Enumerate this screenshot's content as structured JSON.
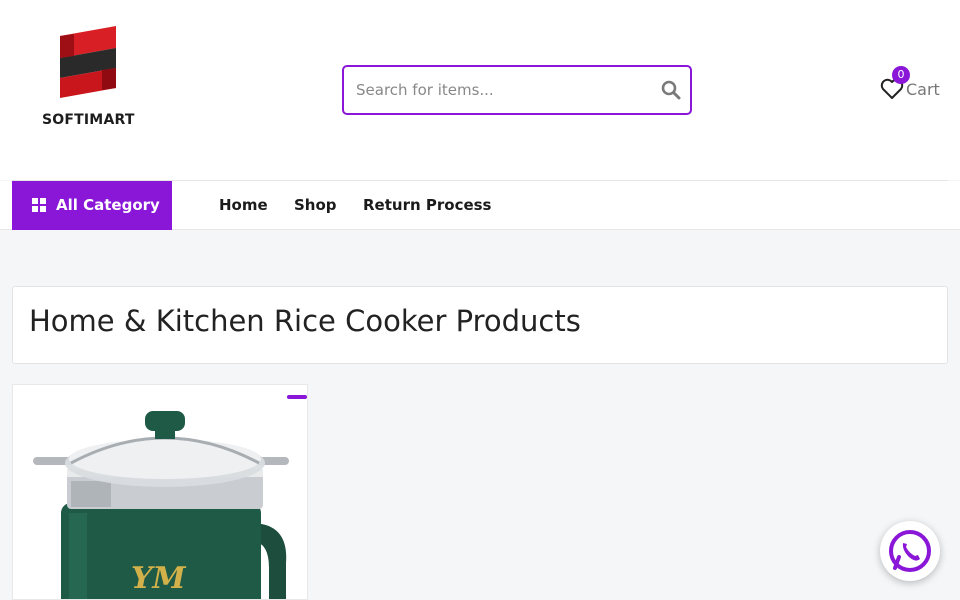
{
  "brand": {
    "name": "SOFTIMART"
  },
  "search": {
    "placeholder": "Search for items..."
  },
  "cart": {
    "count": "0",
    "label": "Cart"
  },
  "nav": {
    "all_category": "All Category",
    "links": [
      "Home",
      "Shop",
      "Return Process"
    ]
  },
  "page": {
    "title": "Home & Kitchen Rice Cooker Products"
  },
  "colors": {
    "accent": "#8a17d8",
    "logo_red": "#d91f26",
    "whatsapp": "#8a17d8"
  },
  "icons": [
    "logo-icon",
    "search-icon",
    "heart-icon",
    "grid-icon",
    "whatsapp-icon"
  ],
  "products": [
    {
      "image": "rice-cooker-green"
    }
  ]
}
